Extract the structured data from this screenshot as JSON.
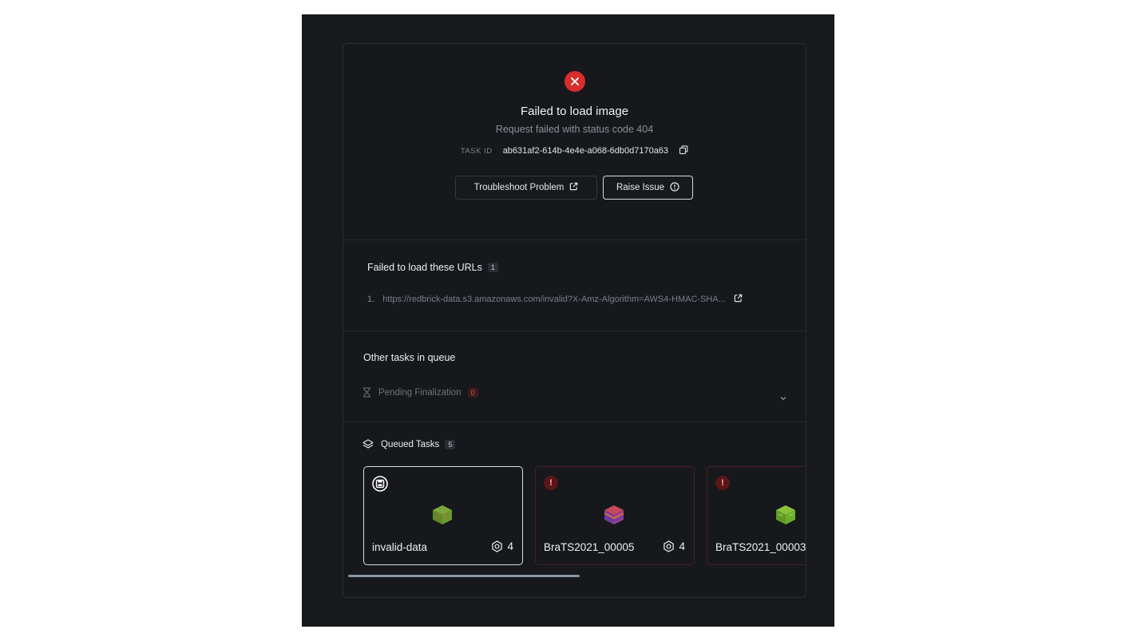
{
  "error": {
    "title": "Failed to load image",
    "subtitle": "Request failed with status code 404",
    "task_id_label": "TASK ID",
    "task_id": "ab631af2-614b-4e4e-a068-6db0d7170a63",
    "icon": "close-icon",
    "buttons": {
      "troubleshoot": "Troubleshoot Problem",
      "raise": "Raise Issue"
    }
  },
  "urls": {
    "title": "Failed to load these URLs",
    "count": "1",
    "items": [
      {
        "num": "1.",
        "url": "https://redbrick-data.s3.amazonaws.com/invalid?X-Amz-Algorithm=AWS4-HMAC-SHA..."
      }
    ]
  },
  "other_tasks": {
    "title": "Other tasks in queue",
    "pending_label": "Pending Finalization",
    "pending_count": "0"
  },
  "queued": {
    "title": "Queued Tasks",
    "count": "5",
    "tiles": [
      {
        "name": "invalid-data",
        "count": "4",
        "state": "active",
        "icon": "save-icon"
      },
      {
        "name": "BraTS2021_00005",
        "count": "4",
        "state": "error",
        "icon": "alert-icon"
      },
      {
        "name": "BraTS2021_00003",
        "count": "",
        "state": "error",
        "icon": "alert-icon"
      }
    ]
  },
  "colors": {
    "error_red": "#d92d2d",
    "background": "#16181c",
    "border": "#2a2d33"
  }
}
